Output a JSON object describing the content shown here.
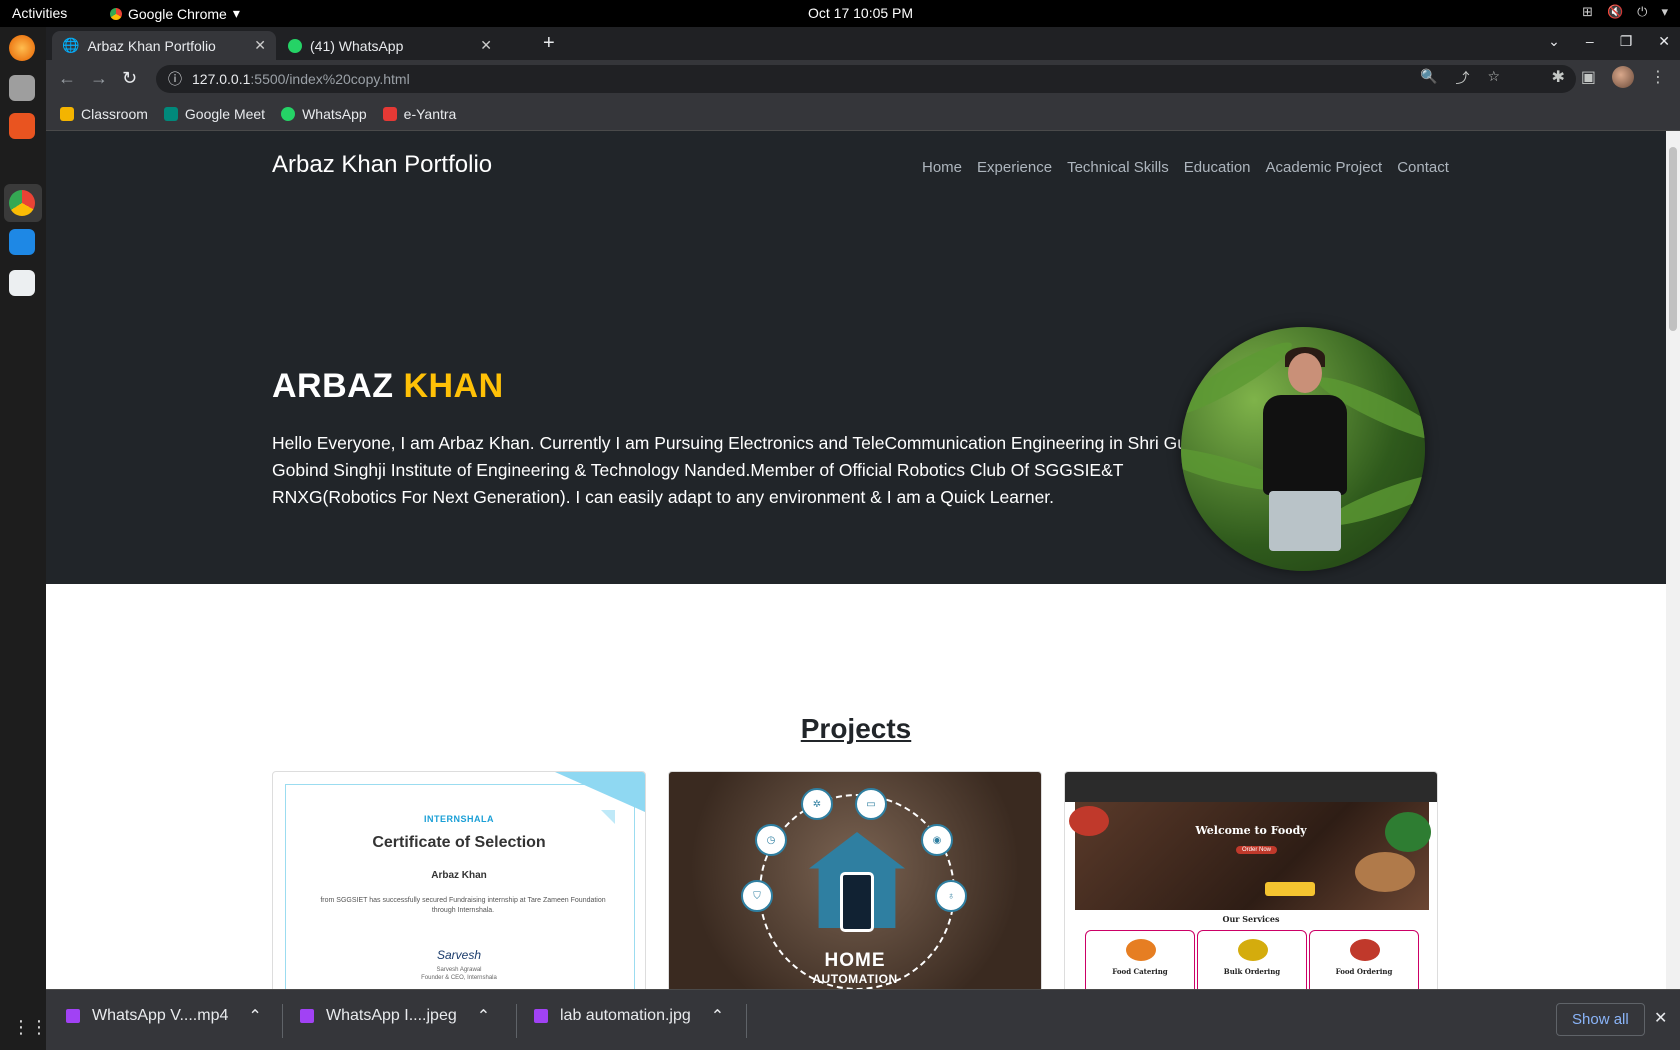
{
  "system": {
    "activities": "Activities",
    "app_name": "Google Chrome",
    "clock": "Oct 17  10:05 PM"
  },
  "browser": {
    "tabs": [
      {
        "label": "Arbaz Khan Portfolio",
        "active": true
      },
      {
        "label": "(41) WhatsApp",
        "active": false
      }
    ],
    "url_host": "127.0.0.1",
    "url_path": ":5500/index%20copy.html",
    "bookmarks": [
      {
        "label": "Classroom",
        "color": "#f4b400"
      },
      {
        "label": "Google Meet",
        "color": "#00897b"
      },
      {
        "label": "WhatsApp",
        "color": "#25d366"
      },
      {
        "label": "e-Yantra",
        "color": "#e53935"
      }
    ]
  },
  "site": {
    "brand": "Arbaz Khan Portfolio",
    "nav": [
      "Home",
      "Experience",
      "Technical Skills",
      "Education",
      "Academic Project",
      "Contact"
    ],
    "hero_first": "ARBAZ",
    "hero_last": "KHAN",
    "hero_text": "Hello Everyone, I am Arbaz Khan. Currently I am Pursuing Electronics and TeleCommunication Engineering in Shri Guru Gobind Singhji Institute of Engineering & Technology Nanded.Member of Official Robotics Club Of SGGSIE&T RNXG(Robotics For Next Generation). I can easily adapt to any environment & I am a Quick Learner.",
    "accent_color": "#ffc107",
    "projects_title": "Projects",
    "cert": {
      "logo": "INTERNSHALA",
      "title": "Certificate of Selection",
      "name": "Arbaz Khan",
      "body": "from SGGSIET has successfully secured Fundraising internship at Tare Zameen Foundation through Internshala.",
      "signature": "Sarvesh",
      "signer": "Sarvesh Agrawal",
      "signer_role": "Founder & CEO, Internshala"
    },
    "home_automation": {
      "line1": "HOME",
      "line2": "AUTOMATION"
    },
    "foody": {
      "welcome": "Welcome to Foody",
      "button": "Order Now",
      "services": "Our Services",
      "cards": [
        "Food Catering",
        "Bulk Ordering",
        "Food Ordering"
      ]
    }
  },
  "downloads": {
    "items": [
      "WhatsApp V....mp4",
      "WhatsApp I....jpeg",
      "lab automation.jpg"
    ],
    "show_all": "Show all"
  }
}
